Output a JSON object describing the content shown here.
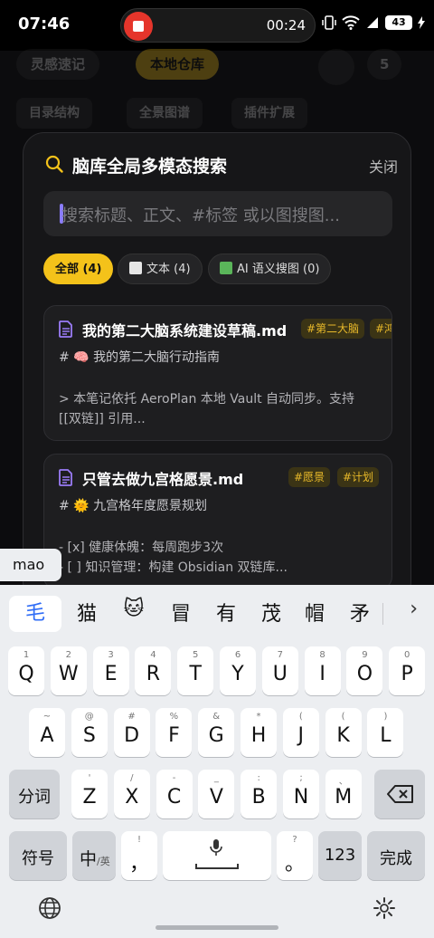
{
  "status_bar": {
    "time": "07:46",
    "record_time": "00:24",
    "battery": "43"
  },
  "background": {
    "tabs": [
      "灵感速记",
      "本地仓库"
    ],
    "badge": "5",
    "subtabs": [
      "目录结构",
      "全景图谱",
      "插件扩展"
    ]
  },
  "modal": {
    "title": "脑库全局多模态搜索",
    "close_label": "关闭",
    "search_placeholder": "搜索标题、正文、#标签 或以图搜图...",
    "filters": [
      {
        "label": "全部 (4)",
        "active": true
      },
      {
        "label": "文本 (4)",
        "active": false
      },
      {
        "label": "AI 语义搜图 (0)",
        "active": false
      }
    ],
    "results": [
      {
        "title": "我的第二大脑系统建设草稿.md",
        "tags": [
          "#第二大脑",
          "#鸿"
        ],
        "heading": "# 🧠 我的第二大脑行动指南",
        "lines": [
          "> 本笔记依托 AeroPlan 本地 Vault 自动同步。支持",
          "[[双链]] 引用..."
        ]
      },
      {
        "title": "只管去做九宫格愿景.md",
        "tags": [
          "#愿景",
          "#计划"
        ],
        "heading": "# 🌞 九宫格年度愿景规划",
        "lines": [
          "- [x] 健康体魄：每周跑步3次",
          "- [ ] 知识管理：构建 Obsidian 双链库..."
        ]
      }
    ]
  },
  "keyboard": {
    "pinyin": "mao",
    "candidates": [
      "毛",
      "猫",
      "🐱",
      "冒",
      "有",
      "茂",
      "帽",
      "矛"
    ],
    "row1": [
      [
        "1",
        "Q"
      ],
      [
        "2",
        "W"
      ],
      [
        "3",
        "E"
      ],
      [
        "4",
        "R"
      ],
      [
        "5",
        "T"
      ],
      [
        "6",
        "Y"
      ],
      [
        "7",
        "U"
      ],
      [
        "8",
        "I"
      ],
      [
        "9",
        "O"
      ],
      [
        "0",
        "P"
      ]
    ],
    "row2": [
      [
        "~",
        "A"
      ],
      [
        "@",
        "S"
      ],
      [
        "#",
        "D"
      ],
      [
        "%",
        "F"
      ],
      [
        "&",
        "G"
      ],
      [
        "*",
        "H"
      ],
      [
        "(",
        "J"
      ],
      [
        "(",
        "K"
      ],
      [
        ")",
        "L"
      ]
    ],
    "row3": [
      [
        "'",
        "Z"
      ],
      [
        "/",
        "X"
      ],
      [
        "-",
        "C"
      ],
      [
        "_",
        "V"
      ],
      [
        ":",
        "B"
      ],
      [
        ";",
        "N"
      ],
      [
        "、",
        "M"
      ]
    ],
    "fn_fenci": "分词",
    "fn_fuhao": "符号",
    "fn_zhong": "中",
    "fn_ying": "/英",
    "fn_comma": "，",
    "fn_comma_sup": "!",
    "fn_period": "。",
    "fn_period_sup": "?",
    "fn_123": "123",
    "fn_done": "完成"
  }
}
